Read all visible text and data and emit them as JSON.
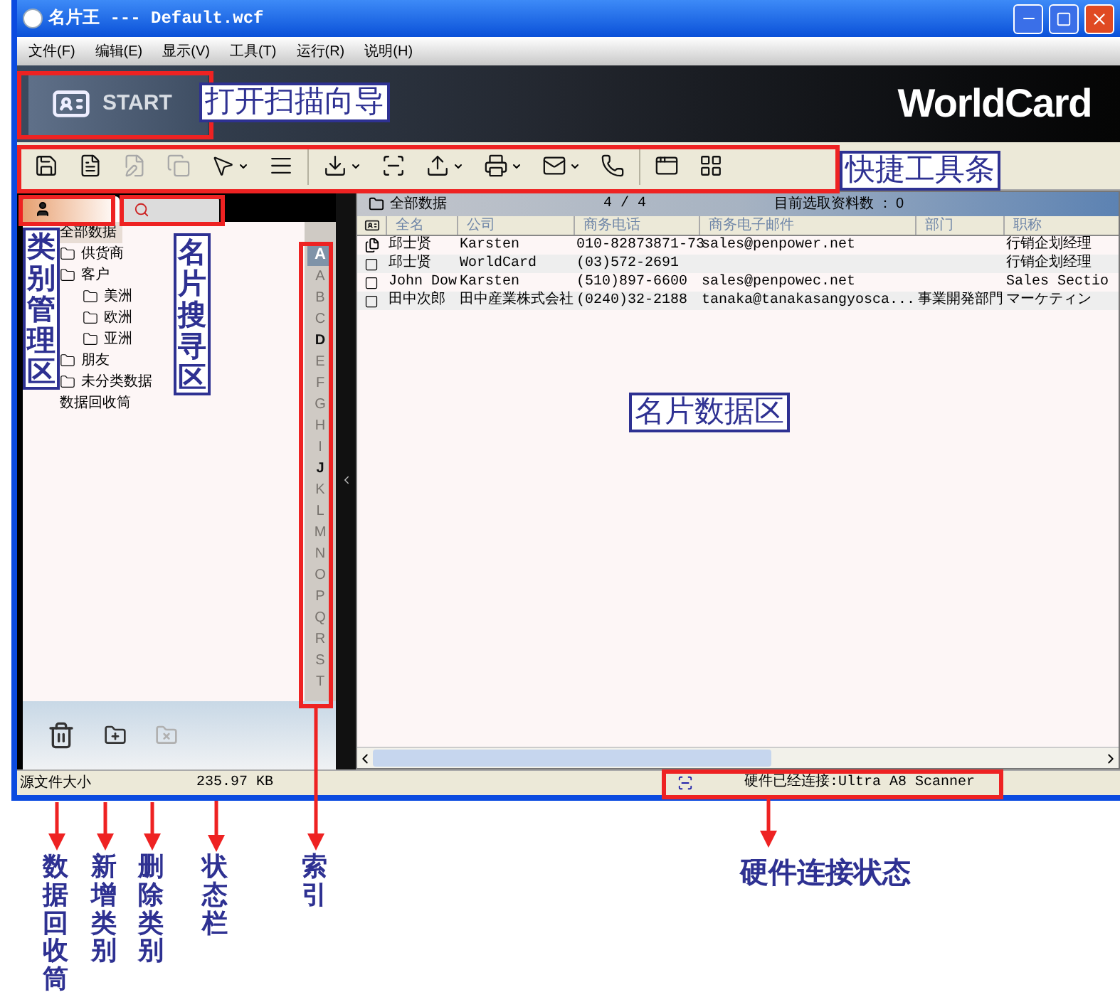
{
  "window": {
    "title": "名片王 --- Default.wcf"
  },
  "menu": [
    {
      "label": "文件(F)"
    },
    {
      "label": "编辑(E)"
    },
    {
      "label": "显示(V)"
    },
    {
      "label": "工具(T)"
    },
    {
      "label": "运行(R)"
    },
    {
      "label": "说明(H)"
    }
  ],
  "banner": {
    "start_label": "START",
    "logo": "WorldCard"
  },
  "toolbar": [
    {
      "kind": "save",
      "disabled": false,
      "dropdown": false
    },
    {
      "kind": "card",
      "disabled": false,
      "dropdown": false
    },
    {
      "kind": "edit",
      "disabled": true,
      "dropdown": false
    },
    {
      "kind": "copy",
      "disabled": true,
      "dropdown": false
    },
    {
      "kind": "pointer",
      "disabled": false,
      "dropdown": true
    },
    {
      "kind": "list",
      "disabled": false,
      "dropdown": false
    },
    {
      "kind": "import",
      "disabled": false,
      "dropdown": true
    },
    {
      "kind": "scan",
      "disabled": false,
      "dropdown": false
    },
    {
      "kind": "export",
      "disabled": false,
      "dropdown": true
    },
    {
      "kind": "print",
      "disabled": false,
      "dropdown": true
    },
    {
      "kind": "mail",
      "disabled": false,
      "dropdown": true
    },
    {
      "kind": "phone",
      "disabled": false,
      "dropdown": false
    },
    {
      "kind": "window",
      "disabled": false,
      "dropdown": false
    },
    {
      "kind": "grid",
      "disabled": false,
      "dropdown": false
    }
  ],
  "category_tabs": [
    {
      "kind": "categories",
      "selected": true
    },
    {
      "kind": "search",
      "selected": false
    }
  ],
  "tree": [
    {
      "label": "全部数据",
      "kind": "root",
      "selected": true,
      "children": [
        {
          "label": "供货商",
          "kind": "folder",
          "selected": false
        },
        {
          "label": "客户",
          "kind": "folder",
          "selected": false,
          "children": [
            {
              "label": "美洲",
              "kind": "folder",
              "selected": false
            },
            {
              "label": "欧洲",
              "kind": "folder",
              "selected": false
            },
            {
              "label": "亚洲",
              "kind": "folder",
              "selected": false
            }
          ]
        },
        {
          "label": "朋友",
          "kind": "folder",
          "selected": false
        },
        {
          "label": "未分类数据",
          "kind": "folder",
          "selected": false
        }
      ]
    },
    {
      "label": "数据回收筒",
      "kind": "root",
      "selected": false
    }
  ],
  "index": {
    "current": "A",
    "letters": [
      {
        "letter": "A",
        "disabled": true
      },
      {
        "letter": "B",
        "disabled": true
      },
      {
        "letter": "C",
        "disabled": true
      },
      {
        "letter": "D",
        "disabled": false
      },
      {
        "letter": "E",
        "disabled": true
      },
      {
        "letter": "F",
        "disabled": true
      },
      {
        "letter": "G",
        "disabled": true
      },
      {
        "letter": "H",
        "disabled": true
      },
      {
        "letter": "I",
        "disabled": true
      },
      {
        "letter": "J",
        "disabled": false
      },
      {
        "letter": "K",
        "disabled": true
      },
      {
        "letter": "L",
        "disabled": true
      },
      {
        "letter": "M",
        "disabled": true
      },
      {
        "letter": "N",
        "disabled": true
      },
      {
        "letter": "O",
        "disabled": true
      },
      {
        "letter": "P",
        "disabled": true
      },
      {
        "letter": "Q",
        "disabled": true
      },
      {
        "letter": "R",
        "disabled": true
      },
      {
        "letter": "S",
        "disabled": true
      },
      {
        "letter": "T",
        "disabled": true
      }
    ]
  },
  "category_tools": [
    {
      "kind": "recycle-bin",
      "disabled": false
    },
    {
      "kind": "new-category",
      "disabled": false
    },
    {
      "kind": "delete-category",
      "disabled": true
    }
  ],
  "list_header": {
    "folder": "全部数据",
    "count": "4 / 4",
    "selected_count": "目前选取资料数 ： 0"
  },
  "table": {
    "columns": [
      "全名",
      "公司",
      "商务电话",
      "商务电子邮件",
      "部门",
      "职称"
    ],
    "rows": [
      {
        "kind": "multi",
        "cells": [
          "邱士贤",
          "Karsten",
          "010-82873871-73",
          "sales@penpower.net",
          "",
          "行销企划经理"
        ]
      },
      {
        "kind": "single",
        "cells": [
          "邱士贤",
          "WorldCard",
          "(03)572-2691",
          "",
          "",
          "行销企划经理"
        ]
      },
      {
        "kind": "single",
        "cells": [
          "John Dow",
          "Karsten",
          "(510)897-6600",
          "sales@penpowec.net",
          "",
          "Sales Sectio"
        ]
      },
      {
        "kind": "single",
        "cells": [
          "田中次郎",
          "田中産業株式会社",
          "(0240)32-2188",
          "tanaka@tanakasangyosca...",
          "事業開発部門",
          "マーケティン"
        ]
      }
    ]
  },
  "status_bar": {
    "label": "源文件大小",
    "size": "235.97 KB",
    "hardware": "硬件已经连接:Ultra A8 Scanner"
  },
  "annotations": {
    "scan_wizard": "打开扫描向导",
    "toolbar": "快捷工具条",
    "category_area": "类别管理区",
    "search_area": "名片搜寻区",
    "data_area": "名片数据区",
    "recycle_bin": "数据回收筒",
    "new_category": "新增类别",
    "delete_category": "删除类别",
    "status_bar": "状态栏",
    "index": "索引",
    "hardware": "硬件连接状态"
  }
}
